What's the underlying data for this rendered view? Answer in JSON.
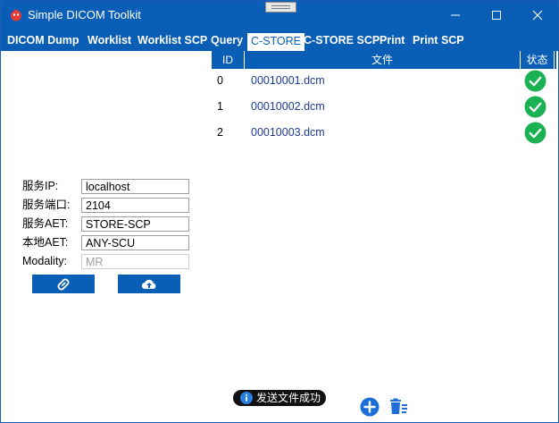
{
  "window": {
    "title": "Simple DICOM Toolkit"
  },
  "tabs": [
    {
      "label": "DICOM Dump",
      "active": false
    },
    {
      "label": "Worklist",
      "active": false
    },
    {
      "label": "Worklist SCP",
      "active": false
    },
    {
      "label": "Query",
      "active": false
    },
    {
      "label": "C-STORE",
      "active": true
    },
    {
      "label": "C-STORE SCP",
      "active": false
    },
    {
      "label": "Print",
      "active": false
    },
    {
      "label": "Print SCP",
      "active": false
    }
  ],
  "file_table": {
    "columns": [
      "ID",
      "文件",
      "状态"
    ],
    "rows": [
      {
        "id": "0",
        "file": "00010001.dcm",
        "status": "success-check-icon"
      },
      {
        "id": "1",
        "file": "00010002.dcm",
        "status": "success-check-icon"
      },
      {
        "id": "2",
        "file": "00010003.dcm",
        "status": "success-check-icon"
      }
    ]
  },
  "form": {
    "server_ip": {
      "label": "服务IP:",
      "value": "localhost"
    },
    "server_port": {
      "label": "服务端口:",
      "value": "2104"
    },
    "server_aet": {
      "label": "服务AET:",
      "value": "STORE-SCP"
    },
    "local_aet": {
      "label": "本地AET:",
      "value": "ANY-SCU"
    },
    "modality": {
      "label": "Modality:",
      "value": "MR",
      "disabled": true
    }
  },
  "buttons": {
    "connect": {
      "icon": "link-icon"
    },
    "upload": {
      "icon": "cloud-upload-icon"
    },
    "add": {
      "icon": "plus-circle-icon"
    },
    "clear": {
      "icon": "trash-list-icon"
    }
  },
  "status": {
    "message": "发送文件成功",
    "icon": "info-icon"
  },
  "colors": {
    "accent": "#0a5eb5",
    "success": "#1ab152",
    "file_text": "#1f3a93"
  }
}
